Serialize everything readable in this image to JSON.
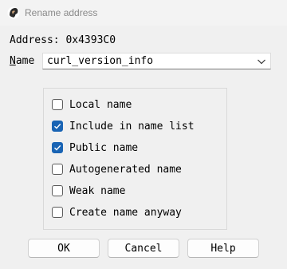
{
  "window": {
    "title": "Rename address"
  },
  "address": {
    "text": "Address: 0x4393C0"
  },
  "name_field": {
    "label_accel": "N",
    "label_rest": "ame",
    "value": "curl_version_info"
  },
  "options": [
    {
      "label": "Local name",
      "checked": false
    },
    {
      "label": "Include in name list",
      "checked": true
    },
    {
      "label": "Public name",
      "checked": true
    },
    {
      "label": "Autogenerated name",
      "checked": false
    },
    {
      "label": "Weak name",
      "checked": false
    },
    {
      "label": "Create name anyway",
      "checked": false
    }
  ],
  "buttons": {
    "ok": "OK",
    "cancel": "Cancel",
    "help": "Help"
  },
  "colors": {
    "accent": "#1964b4",
    "dialog_bg": "#f0f0f0"
  }
}
